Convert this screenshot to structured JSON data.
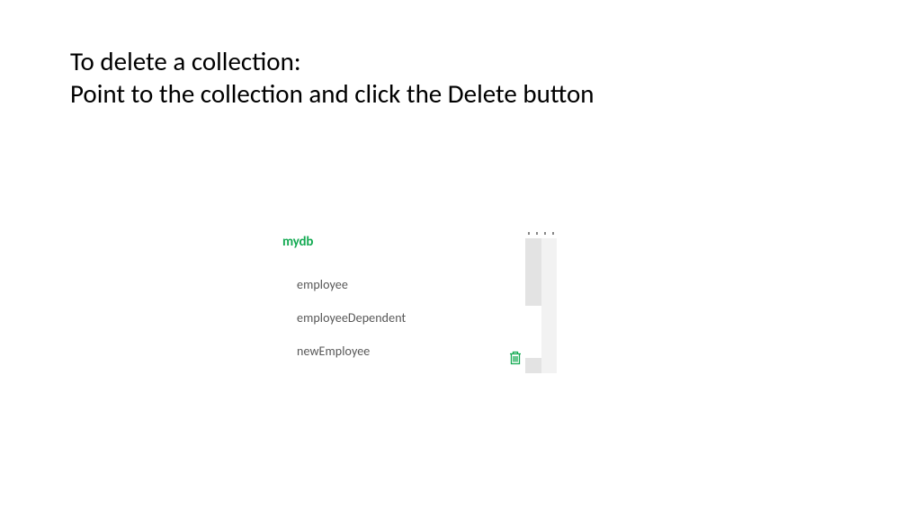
{
  "instruction": {
    "line1": "To delete a collection:",
    "line2": "Point to the collection and click the Delete button"
  },
  "database": {
    "name": "mydb",
    "collections": [
      {
        "name": "employee"
      },
      {
        "name": "employeeDependent"
      },
      {
        "name": "newEmployee"
      }
    ]
  },
  "colors": {
    "accent": "#13aa52"
  }
}
